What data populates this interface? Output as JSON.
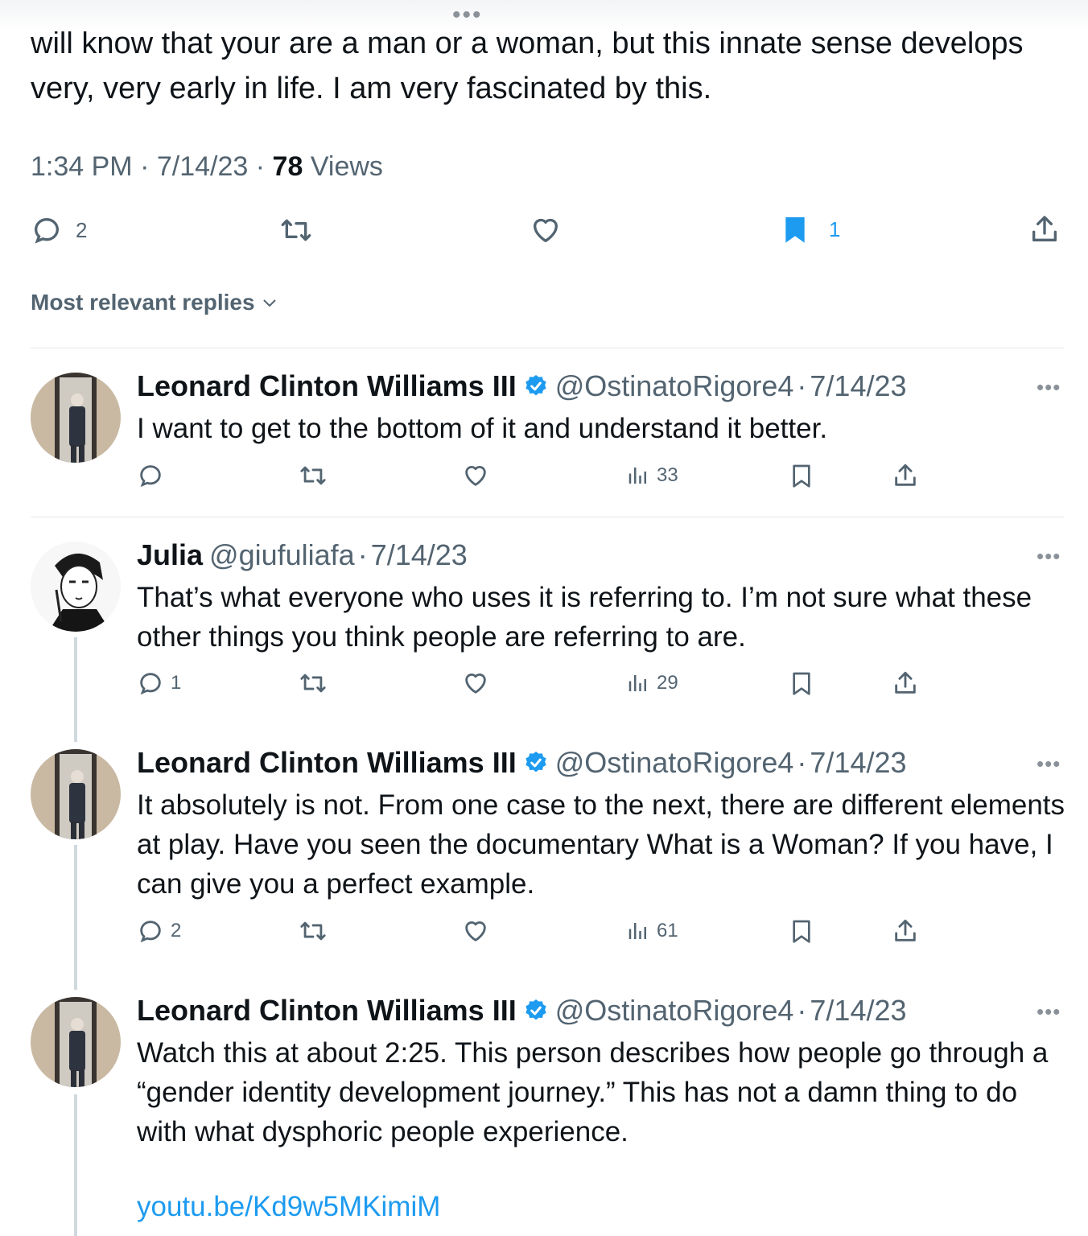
{
  "tweet": {
    "text": "will know that your are a man or a woman, but this innate sense develops very, very early in life. I am very fascinated by this.",
    "time": "1:34 PM",
    "date": "7/14/23",
    "views_count": "78",
    "views_label": "Views",
    "replies": "2",
    "bookmarks": "1"
  },
  "sort": {
    "label": "Most relevant replies"
  },
  "replies": [
    {
      "name": "Leonard Clinton Williams III",
      "handle": "@OstinatoRigore4",
      "date": "7/14/23",
      "text": "I want to get to the bottom of it and understand it better.",
      "reply_count": "",
      "views": "33"
    },
    {
      "name": "Julia",
      "handle": "@giufuliafa",
      "date": "7/14/23",
      "text": "That’s what everyone who uses it is referring to. I’m not sure what these other things you think people are referring to are.",
      "reply_count": "1",
      "views": "29"
    },
    {
      "name": "Leonard Clinton Williams III",
      "handle": "@OstinatoRigore4",
      "date": "7/14/23",
      "text": "It absolutely is not. From one case to the next, there are different elements at play. Have you seen the documentary What is a Woman? If you have, I can give you a perfect example.",
      "reply_count": "2",
      "views": "61"
    },
    {
      "name": "Leonard Clinton Williams III",
      "handle": "@OstinatoRigore4",
      "date": "7/14/23",
      "text": "Watch this at about 2:25. This person describes how people go through a “gender identity development journey.” This has not a damn thing to do with what dysphoric people experience.",
      "link": "youtu.be/Kd9w5MKimiM"
    }
  ],
  "colors": {
    "accent": "#1d9bf0",
    "muted": "#536471",
    "text": "#0f1419"
  }
}
